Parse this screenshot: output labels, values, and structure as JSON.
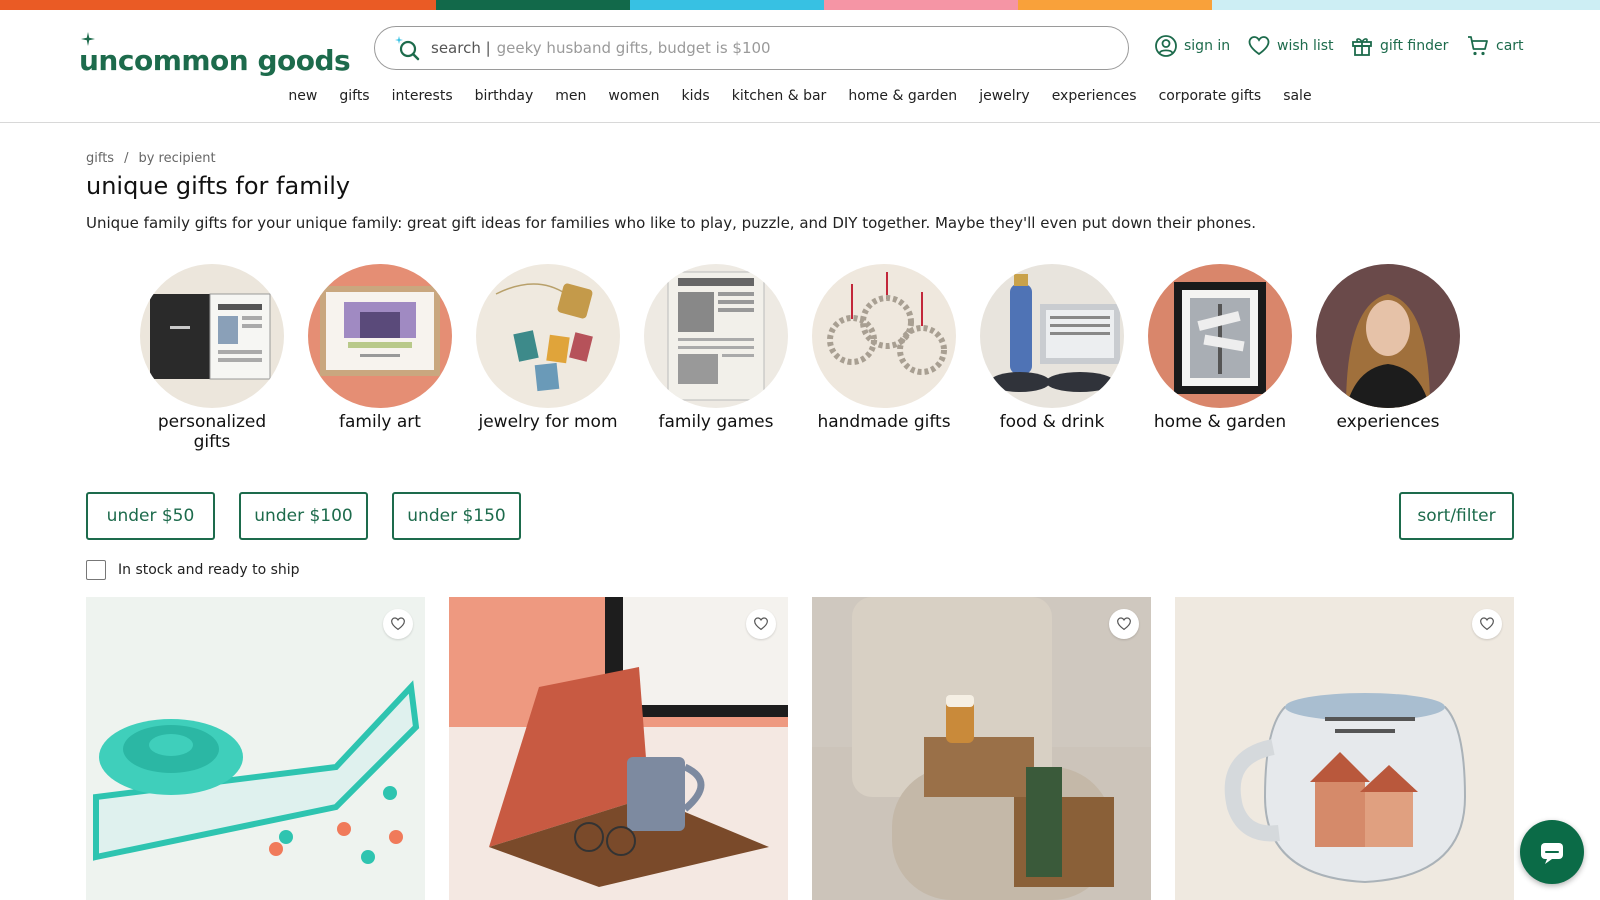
{
  "brand": {
    "logo_text": "uncommon goods",
    "stripe_colors": [
      "#ea5b25",
      "#12694a",
      "#37c1e3",
      "#f595a5",
      "#f9a13a",
      "#cdeef4"
    ]
  },
  "search": {
    "label": "search |",
    "placeholder": "geeky husband gifts, budget is $100"
  },
  "utility_nav": {
    "sign_in": "sign in",
    "wish_list": "wish list",
    "gift_finder": "gift finder",
    "cart": "cart"
  },
  "main_nav": [
    "new",
    "gifts",
    "interests",
    "birthday",
    "men",
    "women",
    "kids",
    "kitchen & bar",
    "home & garden",
    "jewelry",
    "experiences",
    "corporate gifts",
    "sale"
  ],
  "breadcrumb": {
    "items": [
      "gifts",
      "by recipient"
    ],
    "separator": "/"
  },
  "page": {
    "title": "unique gifts for family",
    "intro": "Unique family gifts for your unique family: great gift ideas for families who like to play, puzzle, and DIY together. Maybe they'll even put down their phones."
  },
  "categories": [
    {
      "label": "personalized gifts",
      "icon": "newspaper-book-image"
    },
    {
      "label": "family art",
      "icon": "framed-art-image"
    },
    {
      "label": "jewelry for mom",
      "icon": "necklace-image"
    },
    {
      "label": "family games",
      "icon": "newspaper-puzzle-image"
    },
    {
      "label": "handmade gifts",
      "icon": "ornaments-image"
    },
    {
      "label": "food & drink",
      "icon": "oil-tin-image"
    },
    {
      "label": "home & garden",
      "icon": "street-sign-print-image"
    },
    {
      "label": "experiences",
      "icon": "host-portrait-image"
    }
  ],
  "price_filters": [
    "under $50",
    "under $100",
    "under $150"
  ],
  "sort_filter": "sort/filter",
  "stock_filter": {
    "label": "In stock and ready to ship",
    "checked": false
  },
  "products": [
    {
      "image": "flyball-game-image",
      "bg": "#eef3ef"
    },
    {
      "image": "book-stand-tray-image",
      "bg": "#f2d8cf"
    },
    {
      "image": "sofa-arm-caddy-image",
      "bg": "#d9d3cb"
    },
    {
      "image": "house-mug-image",
      "bg": "#ece7df"
    }
  ],
  "colors": {
    "accent": "#1d6b4c",
    "chat_bg": "#0b6b47"
  }
}
